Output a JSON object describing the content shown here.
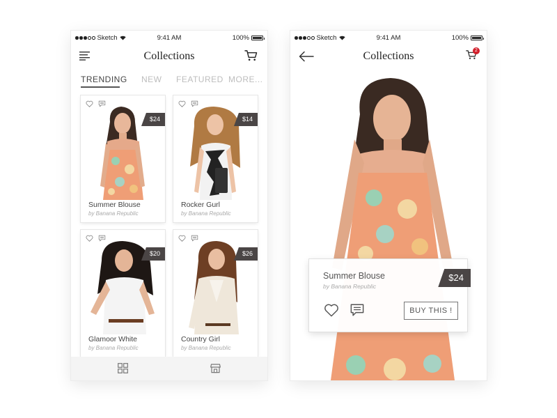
{
  "colors": {
    "accent_dark": "#4a4545",
    "badge_red": "#d21f2b",
    "tab_inactive": "#bdbdbd"
  },
  "status_bar": {
    "carrier": "Sketch",
    "time": "9:41 AM",
    "battery": "100%"
  },
  "left_screen": {
    "title": "Collections",
    "menu_icon": "hamburger-menu-icon",
    "cart_icon": "shopping-cart-icon",
    "tabs": [
      "TRENDING",
      "NEW",
      "FEATURED",
      "MORE..."
    ],
    "active_tab": "TRENDING",
    "products": [
      {
        "name": "Summer Blouse",
        "brand": "by Banana Republic",
        "price": "$24"
      },
      {
        "name": "Rocker Gurl",
        "brand": "by Banana Republic",
        "price": "$14"
      },
      {
        "name": "Glamoor White",
        "brand": "by Banana Republic",
        "price": "$20"
      },
      {
        "name": "Country Girl",
        "brand": "by Banana Republic",
        "price": "$26"
      }
    ],
    "tab_bar_icons": [
      "grid-view-icon",
      "store-icon"
    ]
  },
  "right_screen": {
    "title": "Collections",
    "back_icon": "back-arrow-icon",
    "cart_icon": "shopping-cart-icon",
    "cart_count": "2",
    "product": {
      "name": "Summer Blouse",
      "brand": "by Banana Republic",
      "price": "$24",
      "buy_label": "BUY THIS !"
    }
  }
}
